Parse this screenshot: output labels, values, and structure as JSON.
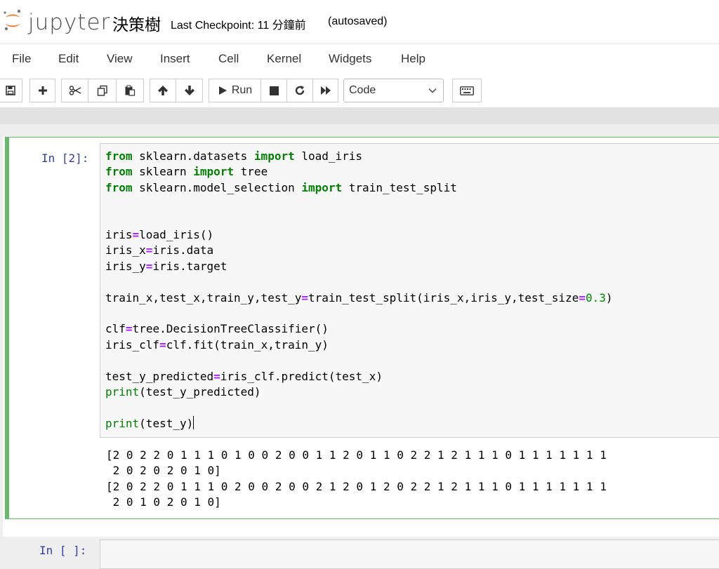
{
  "header": {
    "logo_text": "jupyter",
    "notebook_title": "決策樹",
    "checkpoint": "Last Checkpoint: 11 分鐘前",
    "autosave_status": "(autosaved)"
  },
  "menu": [
    "File",
    "Edit",
    "View",
    "Insert",
    "Cell",
    "Kernel",
    "Widgets",
    "Help"
  ],
  "toolbar": {
    "run_label": "Run",
    "cell_type": "Code",
    "icons": [
      "save-icon",
      "plus-icon",
      "scissors-icon",
      "copy-icon",
      "paste-icon",
      "arrow-up-icon",
      "arrow-down-icon",
      "play-icon",
      "stop-icon",
      "restart-icon",
      "fast-forward-icon",
      "keyboard-icon"
    ]
  },
  "cell": {
    "prompt": "In [2]:",
    "code_lines": [
      "from sklearn.datasets import load_iris",
      "from sklearn import tree",
      "from sklearn.model_selection import train_test_split",
      "",
      "",
      "iris=load_iris()",
      "iris_x=iris.data",
      "iris_y=iris.target",
      "",
      "train_x,test_x,train_y,test_y=train_test_split(iris_x,iris_y,test_size=0.3)",
      "",
      "clf=tree.DecisionTreeClassifier()",
      "iris_clf=clf.fit(train_x,train_y)",
      "",
      "test_y_predicted=iris_clf.predict(test_x)",
      "print(test_y_predicted)",
      "",
      "print(test_y)"
    ],
    "output_lines": [
      "[2 0 2 2 0 1 1 1 0 1 0 0 2 0 0 1 1 2 0 1 1 0 2 2 1 2 1 1 1 0 1 1 1 1 1 1 1",
      " 2 0 2 0 2 0 1 0]",
      "[2 0 2 2 0 1 1 1 0 2 0 0 2 0 0 2 1 2 0 1 2 0 2 2 1 2 1 1 1 0 1 1 1 1 1 1 1",
      " 2 0 1 0 2 0 1 0]"
    ]
  },
  "next_cell": {
    "prompt": "In [ ]:"
  },
  "colors": {
    "keyword": "#008000",
    "operator": "#aa22ff",
    "number": "#008800",
    "prompt": "#303f9f",
    "selected_cell_border": "#66bb6a",
    "logo_orange": "#f37726"
  }
}
